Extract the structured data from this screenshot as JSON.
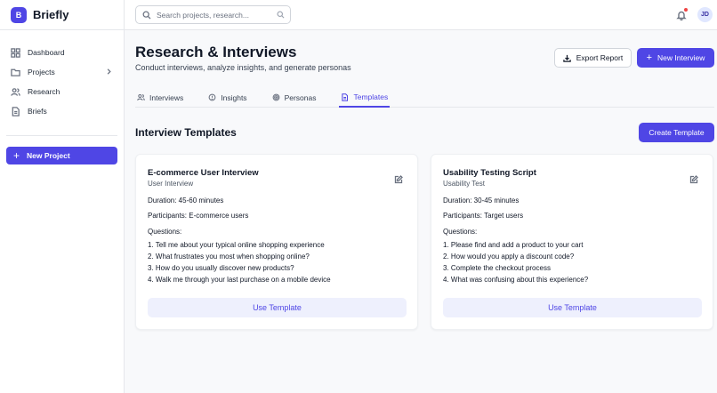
{
  "app": {
    "logo_letter": "B",
    "name": "Briefly"
  },
  "sidebar": {
    "items": [
      {
        "label": "Dashboard",
        "icon": "dashboard-icon"
      },
      {
        "label": "Projects",
        "icon": "folder-icon"
      },
      {
        "label": "Research",
        "icon": "users-icon"
      },
      {
        "label": "Briefs",
        "icon": "document-icon"
      }
    ],
    "new_project_label": "New Project"
  },
  "topbar": {
    "search_placeholder": "Search projects, research...",
    "avatar_initials": "JD"
  },
  "header": {
    "title": "Research & Interviews",
    "subtitle": "Conduct interviews, analyze insights, and generate personas",
    "export_label": "Export Report",
    "new_interview_label": "New Interview"
  },
  "tabs": [
    {
      "label": "Interviews",
      "icon": "users-icon",
      "active": false
    },
    {
      "label": "Insights",
      "icon": "lightbulb-icon",
      "active": false
    },
    {
      "label": "Personas",
      "icon": "target-icon",
      "active": false
    },
    {
      "label": "Templates",
      "icon": "document-icon",
      "active": true
    }
  ],
  "section": {
    "title": "Interview Templates",
    "create_label": "Create Template"
  },
  "templates": [
    {
      "title": "E-commerce User Interview",
      "type": "User Interview",
      "duration": "Duration: 45-60 minutes",
      "participants": "Participants: E-commerce users",
      "questions_label": "Questions:",
      "questions": [
        "1. Tell me about your typical online shopping experience",
        "2. What frustrates you most when shopping online?",
        "3. How do you usually discover new products?",
        "4. Walk me through your last purchase on a mobile device"
      ],
      "use_label": "Use Template"
    },
    {
      "title": "Usability Testing Script",
      "type": "Usability Test",
      "duration": "Duration: 30-45 minutes",
      "participants": "Participants: Target users",
      "questions_label": "Questions:",
      "questions": [
        "1. Please find and add a product to your cart",
        "2. How would you apply a discount code?",
        "3. Complete the checkout process",
        "4. What was confusing about this experience?"
      ],
      "use_label": "Use Template"
    }
  ],
  "colors": {
    "accent": "#4f46e5",
    "accent_soft": "#eef0fd",
    "notification": "#ef4444"
  }
}
